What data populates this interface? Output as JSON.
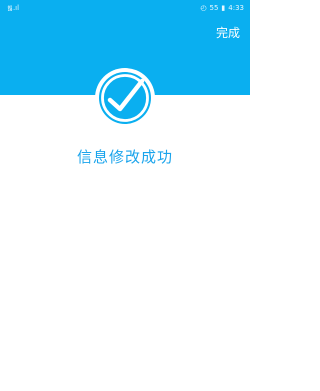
{
  "status_bar": {
    "left_text": "᯾.ıl",
    "right_icons": [
      "alarm-icon",
      "battery-icon"
    ],
    "battery_percent": "55",
    "time": "4:33"
  },
  "header": {
    "done_label": "完成",
    "accent_color": "#0aaff0"
  },
  "result": {
    "icon": "check-circle-icon",
    "message": "信息修改成功",
    "message_color": "#1aa4ec"
  }
}
